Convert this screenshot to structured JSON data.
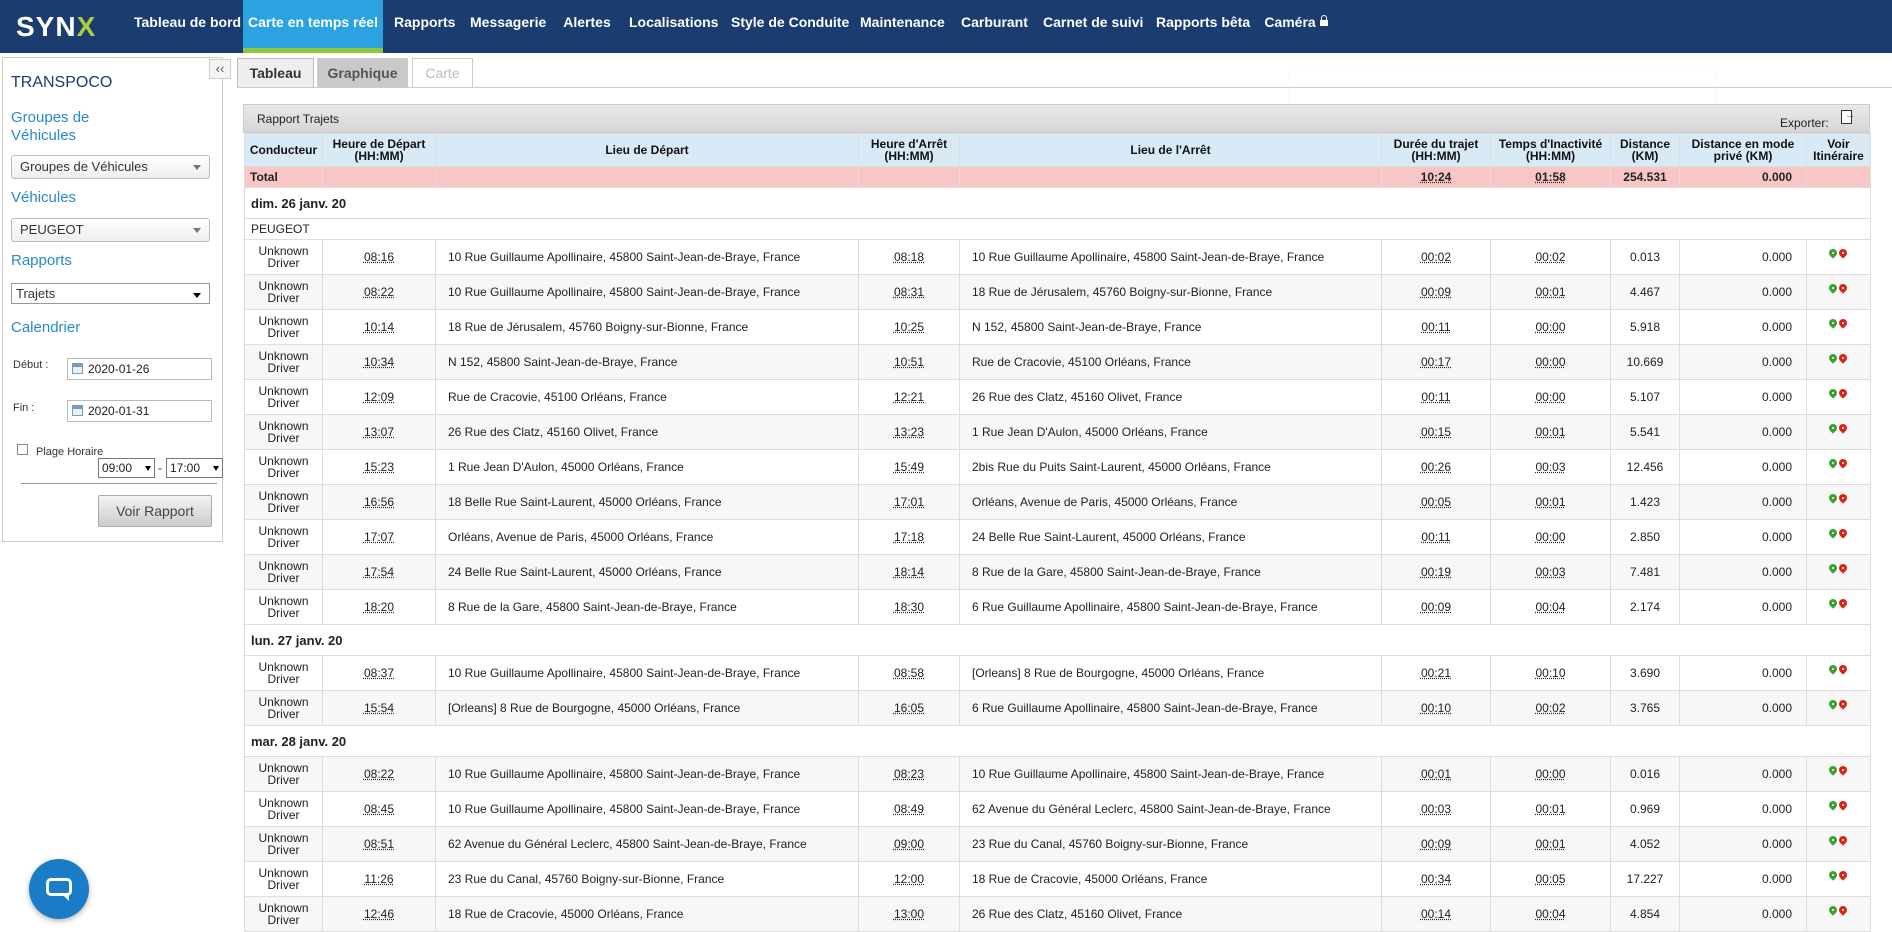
{
  "nav": {
    "logo": "SYN",
    "logo_x": "X",
    "items": [
      "Tableau de bord",
      "Carte en temps réel",
      "Rapports",
      "Messagerie",
      "Alertes",
      "Localisations",
      "Style de Conduite",
      "Maintenance",
      "Carburant",
      "Carnet de suivi",
      "Rapports bêta",
      "Caméra"
    ],
    "active_index": 1
  },
  "sidebar": {
    "company": "TRANSPOCO",
    "collapse": "‹‹",
    "groups_heading": "Groupes de Véhicules",
    "groups_select": "Groupes de Véhicules",
    "vehicles_heading": "Véhicules",
    "vehicles_select": "PEUGEOT",
    "reports_heading": "Rapports",
    "reports_select": "Trajets",
    "calendar_heading": "Calendrier",
    "start_label": "Début :",
    "start_value": "2020-01-26",
    "end_label": "Fin :",
    "end_value": "2020-01-31",
    "plage_label": "Plage Horaire",
    "time_from": "09:00",
    "time_sep": "-",
    "time_to": "17:00",
    "button": "Voir Rapport"
  },
  "tabs": [
    "Tableau",
    "Graphique",
    "Carte"
  ],
  "report": {
    "title": "Rapport Trajets",
    "export_label": "Exporter:",
    "columns": [
      "Conducteur",
      "Heure de Départ (HH:MM)",
      "Lieu de Départ",
      "Heure d'Arrêt (HH:MM)",
      "Lieu de l'Arrêt",
      "Durée du trajet (HH:MM)",
      "Temps d'Inactivité (HH:MM)",
      "Distance (KM)",
      "Distance en mode privé (KM)",
      "Voir Itinéraire"
    ],
    "total": {
      "label": "Total",
      "duration": "10:24",
      "idle": "01:58",
      "distance": "254.531",
      "private": "0.000"
    },
    "vehicle": "PEUGEOT",
    "days": [
      {
        "label": "dim. 26 janv. 20",
        "trips": [
          {
            "driver": "Unknown Driver",
            "dep": "08:16",
            "from": "10 Rue Guillaume Apollinaire, 45800 Saint-Jean-de-Braye, France",
            "arr": "08:18",
            "to": "10 Rue Guillaume Apollinaire, 45800 Saint-Jean-de-Braye, France",
            "dur": "00:02",
            "idle": "00:02",
            "dist": "0.013",
            "priv": "0.000"
          },
          {
            "driver": "Unknown Driver",
            "dep": "08:22",
            "from": "10 Rue Guillaume Apollinaire, 45800 Saint-Jean-de-Braye, France",
            "arr": "08:31",
            "to": "18 Rue de Jérusalem, 45760 Boigny-sur-Bionne, France",
            "dur": "00:09",
            "idle": "00:01",
            "dist": "4.467",
            "priv": "0.000"
          },
          {
            "driver": "Unknown Driver",
            "dep": "10:14",
            "from": "18 Rue de Jérusalem, 45760 Boigny-sur-Bionne, France",
            "arr": "10:25",
            "to": "N 152, 45800 Saint-Jean-de-Braye, France",
            "dur": "00:11",
            "idle": "00:00",
            "dist": "5.918",
            "priv": "0.000"
          },
          {
            "driver": "Unknown Driver",
            "dep": "10:34",
            "from": "N 152, 45800 Saint-Jean-de-Braye, France",
            "arr": "10:51",
            "to": "Rue de Cracovie, 45100 Orléans, France",
            "dur": "00:17",
            "idle": "00:00",
            "dist": "10.669",
            "priv": "0.000"
          },
          {
            "driver": "Unknown Driver",
            "dep": "12:09",
            "from": "Rue de Cracovie, 45100 Orléans, France",
            "arr": "12:21",
            "to": "26 Rue des Clatz, 45160 Olivet, France",
            "dur": "00:11",
            "idle": "00:00",
            "dist": "5.107",
            "priv": "0.000"
          },
          {
            "driver": "Unknown Driver",
            "dep": "13:07",
            "from": "26 Rue des Clatz, 45160 Olivet, France",
            "arr": "13:23",
            "to": "1 Rue Jean D'Aulon, 45000 Orléans, France",
            "dur": "00:15",
            "idle": "00:01",
            "dist": "5.541",
            "priv": "0.000"
          },
          {
            "driver": "Unknown Driver",
            "dep": "15:23",
            "from": "1 Rue Jean D'Aulon, 45000 Orléans, France",
            "arr": "15:49",
            "to": "2bis Rue du Puits Saint-Laurent, 45000 Orléans, France",
            "dur": "00:26",
            "idle": "00:03",
            "dist": "12.456",
            "priv": "0.000"
          },
          {
            "driver": "Unknown Driver",
            "dep": "16:56",
            "from": "18 Belle Rue Saint-Laurent, 45000 Orléans, France",
            "arr": "17:01",
            "to": "Orléans, Avenue de Paris, 45000 Orléans, France",
            "dur": "00:05",
            "idle": "00:01",
            "dist": "1.423",
            "priv": "0.000"
          },
          {
            "driver": "Unknown Driver",
            "dep": "17:07",
            "from": "Orléans, Avenue de Paris, 45000 Orléans, France",
            "arr": "17:18",
            "to": "24 Belle Rue Saint-Laurent, 45000 Orléans, France",
            "dur": "00:11",
            "idle": "00:00",
            "dist": "2.850",
            "priv": "0.000"
          },
          {
            "driver": "Unknown Driver",
            "dep": "17:54",
            "from": "24 Belle Rue Saint-Laurent, 45000 Orléans, France",
            "arr": "18:14",
            "to": "8 Rue de la Gare, 45800 Saint-Jean-de-Braye, France",
            "dur": "00:19",
            "idle": "00:03",
            "dist": "7.481",
            "priv": "0.000"
          },
          {
            "driver": "Unknown Driver",
            "dep": "18:20",
            "from": "8 Rue de la Gare, 45800 Saint-Jean-de-Braye, France",
            "arr": "18:30",
            "to": "6 Rue Guillaume Apollinaire, 45800 Saint-Jean-de-Braye, France",
            "dur": "00:09",
            "idle": "00:04",
            "dist": "2.174",
            "priv": "0.000"
          }
        ]
      },
      {
        "label": "lun. 27 janv. 20",
        "trips": [
          {
            "driver": "Unknown Driver",
            "dep": "08:37",
            "from": "10 Rue Guillaume Apollinaire, 45800 Saint-Jean-de-Braye, France",
            "arr": "08:58",
            "to": "[Orleans] 8 Rue de Bourgogne, 45000 Orléans, France",
            "dur": "00:21",
            "idle": "00:10",
            "dist": "3.690",
            "priv": "0.000"
          },
          {
            "driver": "Unknown Driver",
            "dep": "15:54",
            "from": "[Orleans] 8 Rue de Bourgogne, 45000 Orléans, France",
            "arr": "16:05",
            "to": "6 Rue Guillaume Apollinaire, 45800 Saint-Jean-de-Braye, France",
            "dur": "00:10",
            "idle": "00:02",
            "dist": "3.765",
            "priv": "0.000"
          }
        ]
      },
      {
        "label": "mar. 28 janv. 20",
        "trips": [
          {
            "driver": "Unknown Driver",
            "dep": "08:22",
            "from": "10 Rue Guillaume Apollinaire, 45800 Saint-Jean-de-Braye, France",
            "arr": "08:23",
            "to": "10 Rue Guillaume Apollinaire, 45800 Saint-Jean-de-Braye, France",
            "dur": "00:01",
            "idle": "00:00",
            "dist": "0.016",
            "priv": "0.000"
          },
          {
            "driver": "Unknown Driver",
            "dep": "08:45",
            "from": "10 Rue Guillaume Apollinaire, 45800 Saint-Jean-de-Braye, France",
            "arr": "08:49",
            "to": "62 Avenue du Général Leclerc, 45800 Saint-Jean-de-Braye, France",
            "dur": "00:03",
            "idle": "00:01",
            "dist": "0.969",
            "priv": "0.000"
          },
          {
            "driver": "Unknown Driver",
            "dep": "08:51",
            "from": "62 Avenue du Général Leclerc, 45800 Saint-Jean-de-Braye, France",
            "arr": "09:00",
            "to": "23 Rue du Canal, 45760 Boigny-sur-Bionne, France",
            "dur": "00:09",
            "idle": "00:01",
            "dist": "4.052",
            "priv": "0.000"
          },
          {
            "driver": "Unknown Driver",
            "dep": "11:26",
            "from": "23 Rue du Canal, 45760 Boigny-sur-Bionne, France",
            "arr": "12:00",
            "to": "18 Rue de Cracovie, 45000 Orléans, France",
            "dur": "00:34",
            "idle": "00:05",
            "dist": "17.227",
            "priv": "0.000"
          },
          {
            "driver": "Unknown Driver",
            "dep": "12:46",
            "from": "18 Rue de Cracovie, 45000 Orléans, France",
            "arr": "13:00",
            "to": "26 Rue des Clatz, 45160 Olivet, France",
            "dur": "00:14",
            "idle": "00:04",
            "dist": "4.854",
            "priv": "0.000"
          }
        ]
      }
    ]
  },
  "colors": {
    "nav_bg": "#1a3c6e",
    "nav_active": "#2aa3e0",
    "accent_green": "#8dc63f",
    "header_blue": "#d9eaf7",
    "total_row": "#f9c6c6"
  },
  "icons": {
    "route": "route-pins-icon",
    "export": "export-file-icon",
    "chat": "chat-icon",
    "lock": "lock-icon",
    "calendar": "calendar-icon"
  }
}
